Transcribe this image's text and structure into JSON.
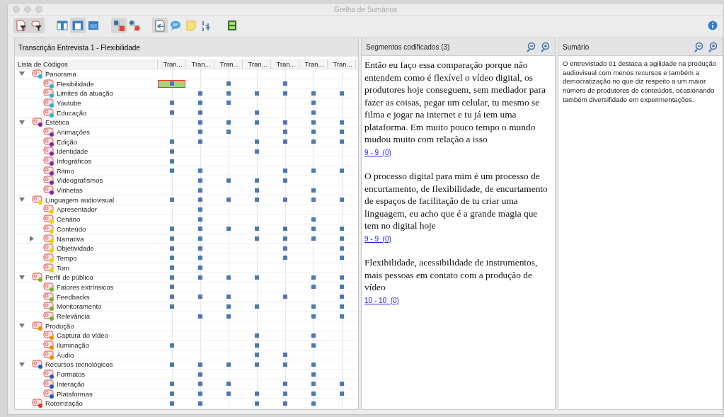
{
  "window": {
    "title": "Grelha de Sumários"
  },
  "toolbar": [
    {
      "kind": "docfilter",
      "selected": true
    },
    {
      "kind": "codefilter",
      "selected": true
    },
    {
      "kind": "layoutleft",
      "selected": false
    },
    {
      "kind": "layoutmid",
      "selected": true
    },
    {
      "kind": "layouttop",
      "selected": false
    },
    {
      "kind": "gridsquare",
      "selected": true
    },
    {
      "kind": "griddot",
      "selected": false
    },
    {
      "kind": "docarrow",
      "selected": true
    },
    {
      "kind": "bubble",
      "selected": false
    },
    {
      "kind": "note",
      "selected": false
    },
    {
      "kind": "letters",
      "selected": false
    },
    {
      "kind": "panel",
      "selected": false
    }
  ],
  "grid_pane": {
    "title": "Transcrição Entrevista 1 - Flexibilidade",
    "first_column": "Lista de Códigos",
    "columns": [
      "Tran...",
      "Tran...",
      "Tran...",
      "Tran...",
      "Tran...",
      "Tran...",
      "Tran..."
    ],
    "codes": [
      {
        "name": "Panorama",
        "color": "#27b6d3",
        "expanded": true,
        "coded": [
          false,
          false,
          false,
          false,
          false,
          false,
          false
        ],
        "selected": [
          false,
          false,
          false,
          false,
          false,
          false,
          false
        ],
        "children": [
          {
            "name": "Flexibilidade",
            "color": "#27b6d3",
            "coded": [
              true,
              false,
              true,
              false,
              true,
              false,
              false
            ],
            "selected": [
              true,
              false,
              false,
              false,
              false,
              false,
              false
            ]
          },
          {
            "name": "Limites da atuação",
            "color": "#27b6d3",
            "coded": [
              false,
              true,
              true,
              true,
              true,
              true,
              true
            ],
            "selected": [
              false,
              false,
              false,
              false,
              false,
              false,
              false
            ]
          },
          {
            "name": "Youtube",
            "color": "#27b6d3",
            "coded": [
              true,
              true,
              true,
              false,
              false,
              true,
              false
            ],
            "selected": [
              false,
              false,
              false,
              false,
              false,
              false,
              false
            ]
          },
          {
            "name": "Educação",
            "color": "#27b6d3",
            "coded": [
              true,
              true,
              false,
              true,
              false,
              true,
              false
            ],
            "selected": [
              false,
              false,
              false,
              false,
              false,
              false,
              false
            ]
          }
        ]
      },
      {
        "name": "Estética",
        "color": "#8e1fa8",
        "expanded": true,
        "coded": [
          false,
          true,
          true,
          true,
          true,
          true,
          true
        ],
        "selected": [
          false,
          false,
          false,
          false,
          false,
          false,
          false
        ],
        "children": [
          {
            "name": "Animações",
            "color": "#8e1fa8",
            "coded": [
              false,
              true,
              true,
              false,
              true,
              true,
              true
            ],
            "selected": [
              false,
              false,
              false,
              false,
              false,
              false,
              false
            ]
          },
          {
            "name": "Edição",
            "color": "#8e1fa8",
            "coded": [
              true,
              true,
              false,
              true,
              true,
              true,
              true
            ],
            "selected": [
              false,
              false,
              false,
              false,
              false,
              false,
              false
            ]
          },
          {
            "name": "Identidade",
            "color": "#8e1fa8",
            "coded": [
              true,
              false,
              false,
              true,
              false,
              false,
              false
            ],
            "selected": [
              false,
              false,
              false,
              false,
              false,
              false,
              false
            ]
          },
          {
            "name": "Infográficos",
            "color": "#8e1fa8",
            "coded": [
              true,
              false,
              false,
              false,
              false,
              false,
              false
            ],
            "selected": [
              false,
              false,
              false,
              false,
              false,
              false,
              false
            ]
          },
          {
            "name": "Ritmo",
            "color": "#8e1fa8",
            "coded": [
              true,
              true,
              false,
              false,
              true,
              true,
              true
            ],
            "selected": [
              false,
              false,
              false,
              false,
              false,
              false,
              false
            ]
          },
          {
            "name": "Videografismos",
            "color": "#8e1fa8",
            "coded": [
              false,
              true,
              true,
              true,
              true,
              false,
              false
            ],
            "selected": [
              false,
              false,
              false,
              false,
              false,
              false,
              false
            ]
          },
          {
            "name": "Vinhetas",
            "color": "#8e1fa8",
            "coded": [
              false,
              true,
              false,
              true,
              false,
              true,
              false
            ],
            "selected": [
              false,
              false,
              false,
              false,
              false,
              false,
              false
            ]
          }
        ]
      },
      {
        "name": "Linguagem audiovisual",
        "color": "#f2cf00",
        "expanded": true,
        "coded": [
          true,
          true,
          true,
          true,
          true,
          true,
          true
        ],
        "selected": [
          false,
          false,
          false,
          false,
          false,
          false,
          false
        ],
        "children": [
          {
            "name": "Apresentador",
            "color": "#f2cf00",
            "coded": [
              false,
              true,
              false,
              false,
              false,
              false,
              false
            ],
            "selected": [
              false,
              false,
              false,
              false,
              false,
              false,
              false
            ]
          },
          {
            "name": "Cenário",
            "color": "#f2cf00",
            "coded": [
              false,
              true,
              false,
              false,
              false,
              true,
              false
            ],
            "selected": [
              false,
              false,
              false,
              false,
              false,
              false,
              false
            ]
          },
          {
            "name": "Conteúdo",
            "color": "#f2cf00",
            "coded": [
              true,
              true,
              true,
              true,
              true,
              true,
              true
            ],
            "selected": [
              false,
              false,
              false,
              false,
              false,
              false,
              false
            ]
          },
          {
            "name": "Narrativa",
            "color": "#f2cf00",
            "expanded": false,
            "coded": [
              true,
              true,
              false,
              true,
              true,
              true,
              true
            ],
            "selected": [
              false,
              false,
              false,
              false,
              false,
              false,
              false
            ]
          },
          {
            "name": "Objetividade",
            "color": "#f2cf00",
            "coded": [
              true,
              true,
              false,
              false,
              true,
              false,
              true
            ],
            "selected": [
              false,
              false,
              false,
              false,
              false,
              false,
              false
            ]
          },
          {
            "name": "Tempo",
            "color": "#f2cf00",
            "coded": [
              true,
              true,
              false,
              false,
              true,
              false,
              true
            ],
            "selected": [
              false,
              false,
              false,
              false,
              false,
              false,
              false
            ]
          },
          {
            "name": "Tom",
            "color": "#f2cf00",
            "coded": [
              true,
              true,
              false,
              false,
              false,
              false,
              false
            ],
            "selected": [
              false,
              false,
              false,
              false,
              false,
              false,
              false
            ]
          }
        ]
      },
      {
        "name": "Perfil de público",
        "color": "#6cb82a",
        "expanded": true,
        "coded": [
          true,
          true,
          true,
          true,
          false,
          true,
          true
        ],
        "selected": [
          false,
          false,
          false,
          false,
          false,
          false,
          false
        ],
        "children": [
          {
            "name": "Fatores extrínsicos",
            "color": "#6cb82a",
            "coded": [
              true,
              false,
              false,
              false,
              false,
              true,
              true
            ],
            "selected": [
              false,
              false,
              false,
              false,
              false,
              false,
              false
            ]
          },
          {
            "name": "Feedbacks",
            "color": "#6cb82a",
            "coded": [
              true,
              true,
              true,
              false,
              true,
              false,
              true
            ],
            "selected": [
              false,
              false,
              false,
              false,
              false,
              false,
              false
            ]
          },
          {
            "name": "Monitoramento",
            "color": "#6cb82a",
            "coded": [
              true,
              false,
              true,
              true,
              false,
              true,
              true
            ],
            "selected": [
              false,
              false,
              false,
              false,
              false,
              false,
              false
            ]
          },
          {
            "name": "Relevância",
            "color": "#6cb82a",
            "coded": [
              false,
              true,
              true,
              false,
              false,
              true,
              true
            ],
            "selected": [
              false,
              false,
              false,
              false,
              false,
              false,
              false
            ]
          }
        ]
      },
      {
        "name": "Produção",
        "color": "#f08a00",
        "expanded": true,
        "coded": [
          false,
          false,
          false,
          false,
          false,
          false,
          false
        ],
        "selected": [
          false,
          false,
          false,
          false,
          false,
          false,
          false
        ],
        "children": [
          {
            "name": "Captura do vídeo",
            "color": "#f08a00",
            "coded": [
              false,
              false,
              false,
              true,
              false,
              true,
              false
            ],
            "selected": [
              false,
              false,
              false,
              false,
              false,
              false,
              false
            ]
          },
          {
            "name": "Iluminação",
            "color": "#f08a00",
            "coded": [
              true,
              false,
              false,
              true,
              false,
              true,
              false
            ],
            "selected": [
              false,
              false,
              false,
              false,
              false,
              false,
              false
            ]
          },
          {
            "name": "Áudio",
            "color": "#f08a00",
            "coded": [
              false,
              false,
              false,
              true,
              true,
              false,
              false
            ],
            "selected": [
              false,
              false,
              false,
              false,
              false,
              false,
              false
            ]
          }
        ]
      },
      {
        "name": "Recursos tecnológicos",
        "color": "#1f5fc0",
        "expanded": true,
        "coded": [
          true,
          true,
          true,
          true,
          true,
          true,
          false
        ],
        "selected": [
          false,
          false,
          false,
          false,
          false,
          false,
          false
        ],
        "children": [
          {
            "name": "Formatos",
            "color": "#1f5fc0",
            "coded": [
              false,
              true,
              false,
              false,
              false,
              true,
              false
            ],
            "selected": [
              false,
              false,
              false,
              false,
              false,
              false,
              false
            ]
          },
          {
            "name": "Interação",
            "color": "#1f5fc0",
            "coded": [
              true,
              true,
              true,
              false,
              true,
              true,
              true
            ],
            "selected": [
              false,
              false,
              false,
              false,
              false,
              false,
              false
            ]
          },
          {
            "name": "Plataformas",
            "color": "#1f5fc0",
            "coded": [
              true,
              true,
              true,
              true,
              true,
              true,
              true
            ],
            "selected": [
              false,
              false,
              false,
              false,
              false,
              false,
              false
            ]
          }
        ]
      },
      {
        "name": "Roteirização",
        "color": "#e2341c",
        "coded": [
          true,
          true,
          false,
          true,
          true,
          true,
          false
        ],
        "selected": [
          false,
          false,
          false,
          false,
          false,
          false,
          false
        ]
      }
    ]
  },
  "segments_pane": {
    "title": "Segmentos codificados (3)",
    "segments": [
      {
        "text": "Então eu faço essa comparação porque não entendem como é flexível o vídeo digital, os produtores hoje conseguem, sem mediador para fazer as coisas, pegar um celular, tu mesmo se filma e jogar na internet e tu já tem uma plataforma. Em muito pouco tempo o mundo mudou muito com relação a isso",
        "link": "9 - 9  (0)"
      },
      {
        "text": "O processo digital para mim é um processo de encurtamento, de flexibilidade, de encurtamento de espaços de facilitação de tu criar uma linguagem, eu acho que é a grande magia que tem no digital hoje",
        "link": "9 - 9  (0)"
      },
      {
        "text": "Flexibilidade, acessibilidade de instrumentos, mais pessoas em contato com a produção de vídeo",
        "link": "10 - 10  (0)"
      }
    ]
  },
  "summary_pane": {
    "title": "Sumário",
    "text": "O entrevistado 01 destaca a agilidade na produção audiovisual com menos recursos e também a democratização no que diz respeito a um maior número de produtores de conteúdos, ocasionando também diversifidade em experimentações."
  }
}
